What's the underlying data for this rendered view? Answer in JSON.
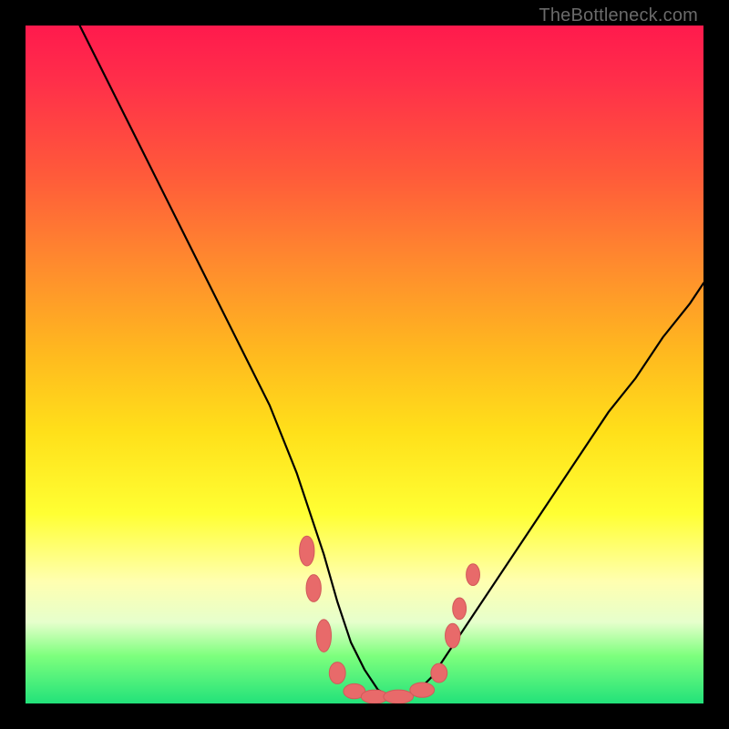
{
  "watermark": "TheBottleneck.com",
  "chart_data": {
    "type": "line",
    "title": "",
    "xlabel": "",
    "ylabel": "",
    "xlim": [
      0,
      100
    ],
    "ylim": [
      0,
      100
    ],
    "grid": false,
    "series": [
      {
        "name": "curve",
        "x": [
          8,
          12,
          16,
          20,
          24,
          28,
          32,
          36,
          40,
          42,
          44,
          46,
          48,
          50,
          52,
          54,
          56,
          58,
          60,
          62,
          66,
          70,
          74,
          78,
          82,
          86,
          90,
          94,
          98,
          100
        ],
        "y": [
          100,
          92,
          84,
          76,
          68,
          60,
          52,
          44,
          34,
          28,
          22,
          15,
          9,
          5,
          2,
          1,
          1,
          2,
          4,
          7,
          13,
          19,
          25,
          31,
          37,
          43,
          48,
          54,
          59,
          62
        ]
      }
    ],
    "markers": [
      {
        "x": 41.5,
        "y": 22.5,
        "rx": 1.1,
        "ry": 2.2
      },
      {
        "x": 42.5,
        "y": 17.0,
        "rx": 1.1,
        "ry": 2.0
      },
      {
        "x": 44.0,
        "y": 10.0,
        "rx": 1.1,
        "ry": 2.4
      },
      {
        "x": 46.0,
        "y": 4.5,
        "rx": 1.2,
        "ry": 1.6
      },
      {
        "x": 48.5,
        "y": 1.8,
        "rx": 1.6,
        "ry": 1.1
      },
      {
        "x": 51.5,
        "y": 1.0,
        "rx": 2.0,
        "ry": 1.0
      },
      {
        "x": 55.0,
        "y": 1.0,
        "rx": 2.2,
        "ry": 1.0
      },
      {
        "x": 58.5,
        "y": 2.0,
        "rx": 1.8,
        "ry": 1.1
      },
      {
        "x": 61.0,
        "y": 4.5,
        "rx": 1.2,
        "ry": 1.4
      },
      {
        "x": 63.0,
        "y": 10.0,
        "rx": 1.1,
        "ry": 1.8
      },
      {
        "x": 64.0,
        "y": 14.0,
        "rx": 1.0,
        "ry": 1.6
      },
      {
        "x": 66.0,
        "y": 19.0,
        "rx": 1.0,
        "ry": 1.6
      }
    ],
    "colors": {
      "curve": "#000000",
      "marker_fill": "#e86a6a",
      "marker_stroke": "#d15a5a"
    }
  }
}
